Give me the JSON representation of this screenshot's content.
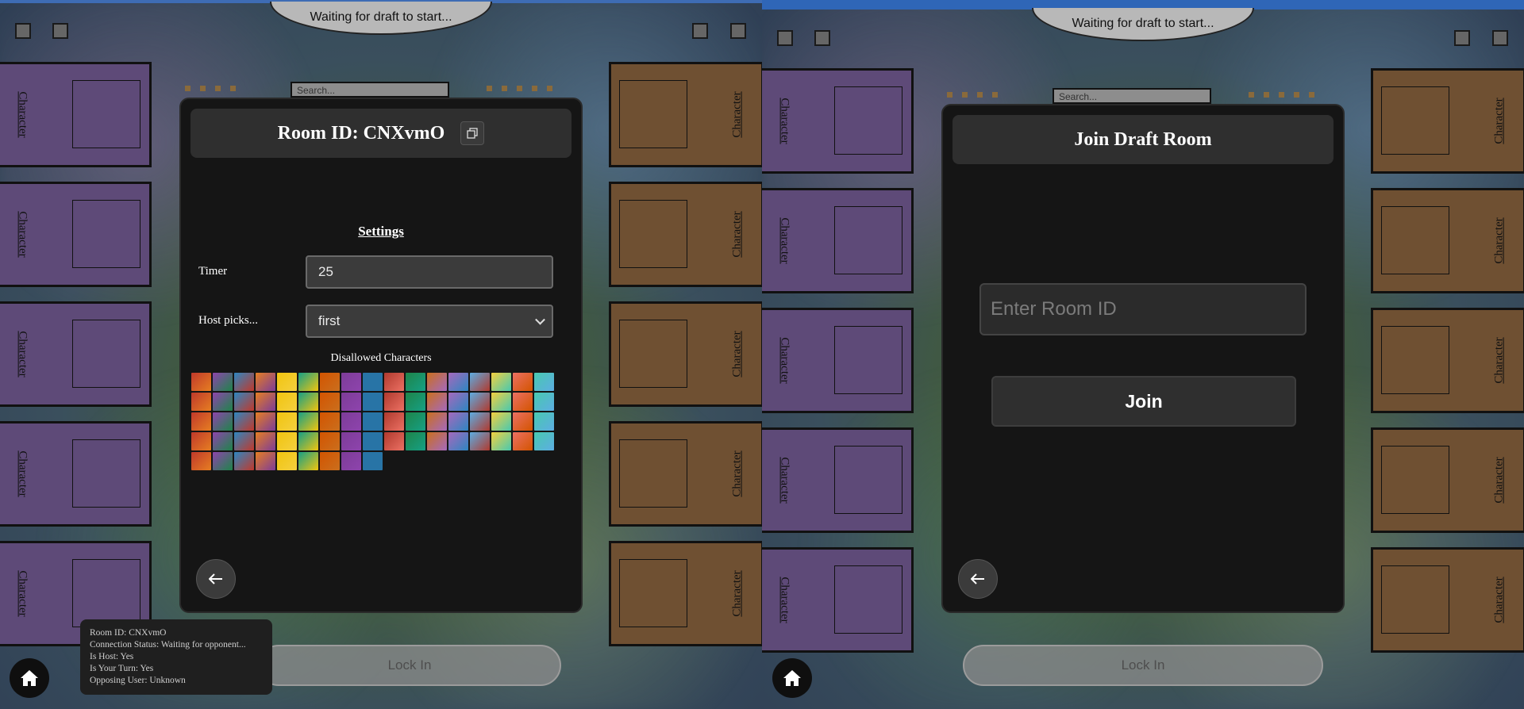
{
  "left_pane": {
    "status": "Waiting for draft to start...",
    "search_placeholder": "Search...",
    "slot_label": "Character",
    "room_title": "Room ID: CNXvmO",
    "settings": {
      "title": "Settings",
      "timer_label": "Timer",
      "timer_value": "25",
      "host_picks_label": "Host picks...",
      "host_picks_value": "first",
      "disallowed_title": "Disallowed Characters"
    },
    "lock_in": "Lock In",
    "info": {
      "room_id": "Room ID: CNXvmO",
      "connection": "Connection Status: Waiting for opponent...",
      "is_host": "Is Host: Yes",
      "is_your_turn": "Is Your Turn: Yes",
      "opposing_user": "Opposing User: Unknown"
    }
  },
  "right_pane": {
    "status": "Waiting for draft to start...",
    "search_placeholder": "Search...",
    "slot_label": "Character",
    "join_title": "Join Draft Room",
    "room_id_placeholder": "Enter Room ID",
    "join_button": "Join",
    "lock_in": "Lock In"
  },
  "colors": {
    "purple_slot": "#5e4a78",
    "brown_slot": "#6f5032",
    "modal_bg": "#151515",
    "topbar": "#3e6cb4"
  },
  "icons": {
    "copy": "copy-icon",
    "back": "arrow-left-icon",
    "home": "home-icon"
  },
  "character_tile_count": 77
}
